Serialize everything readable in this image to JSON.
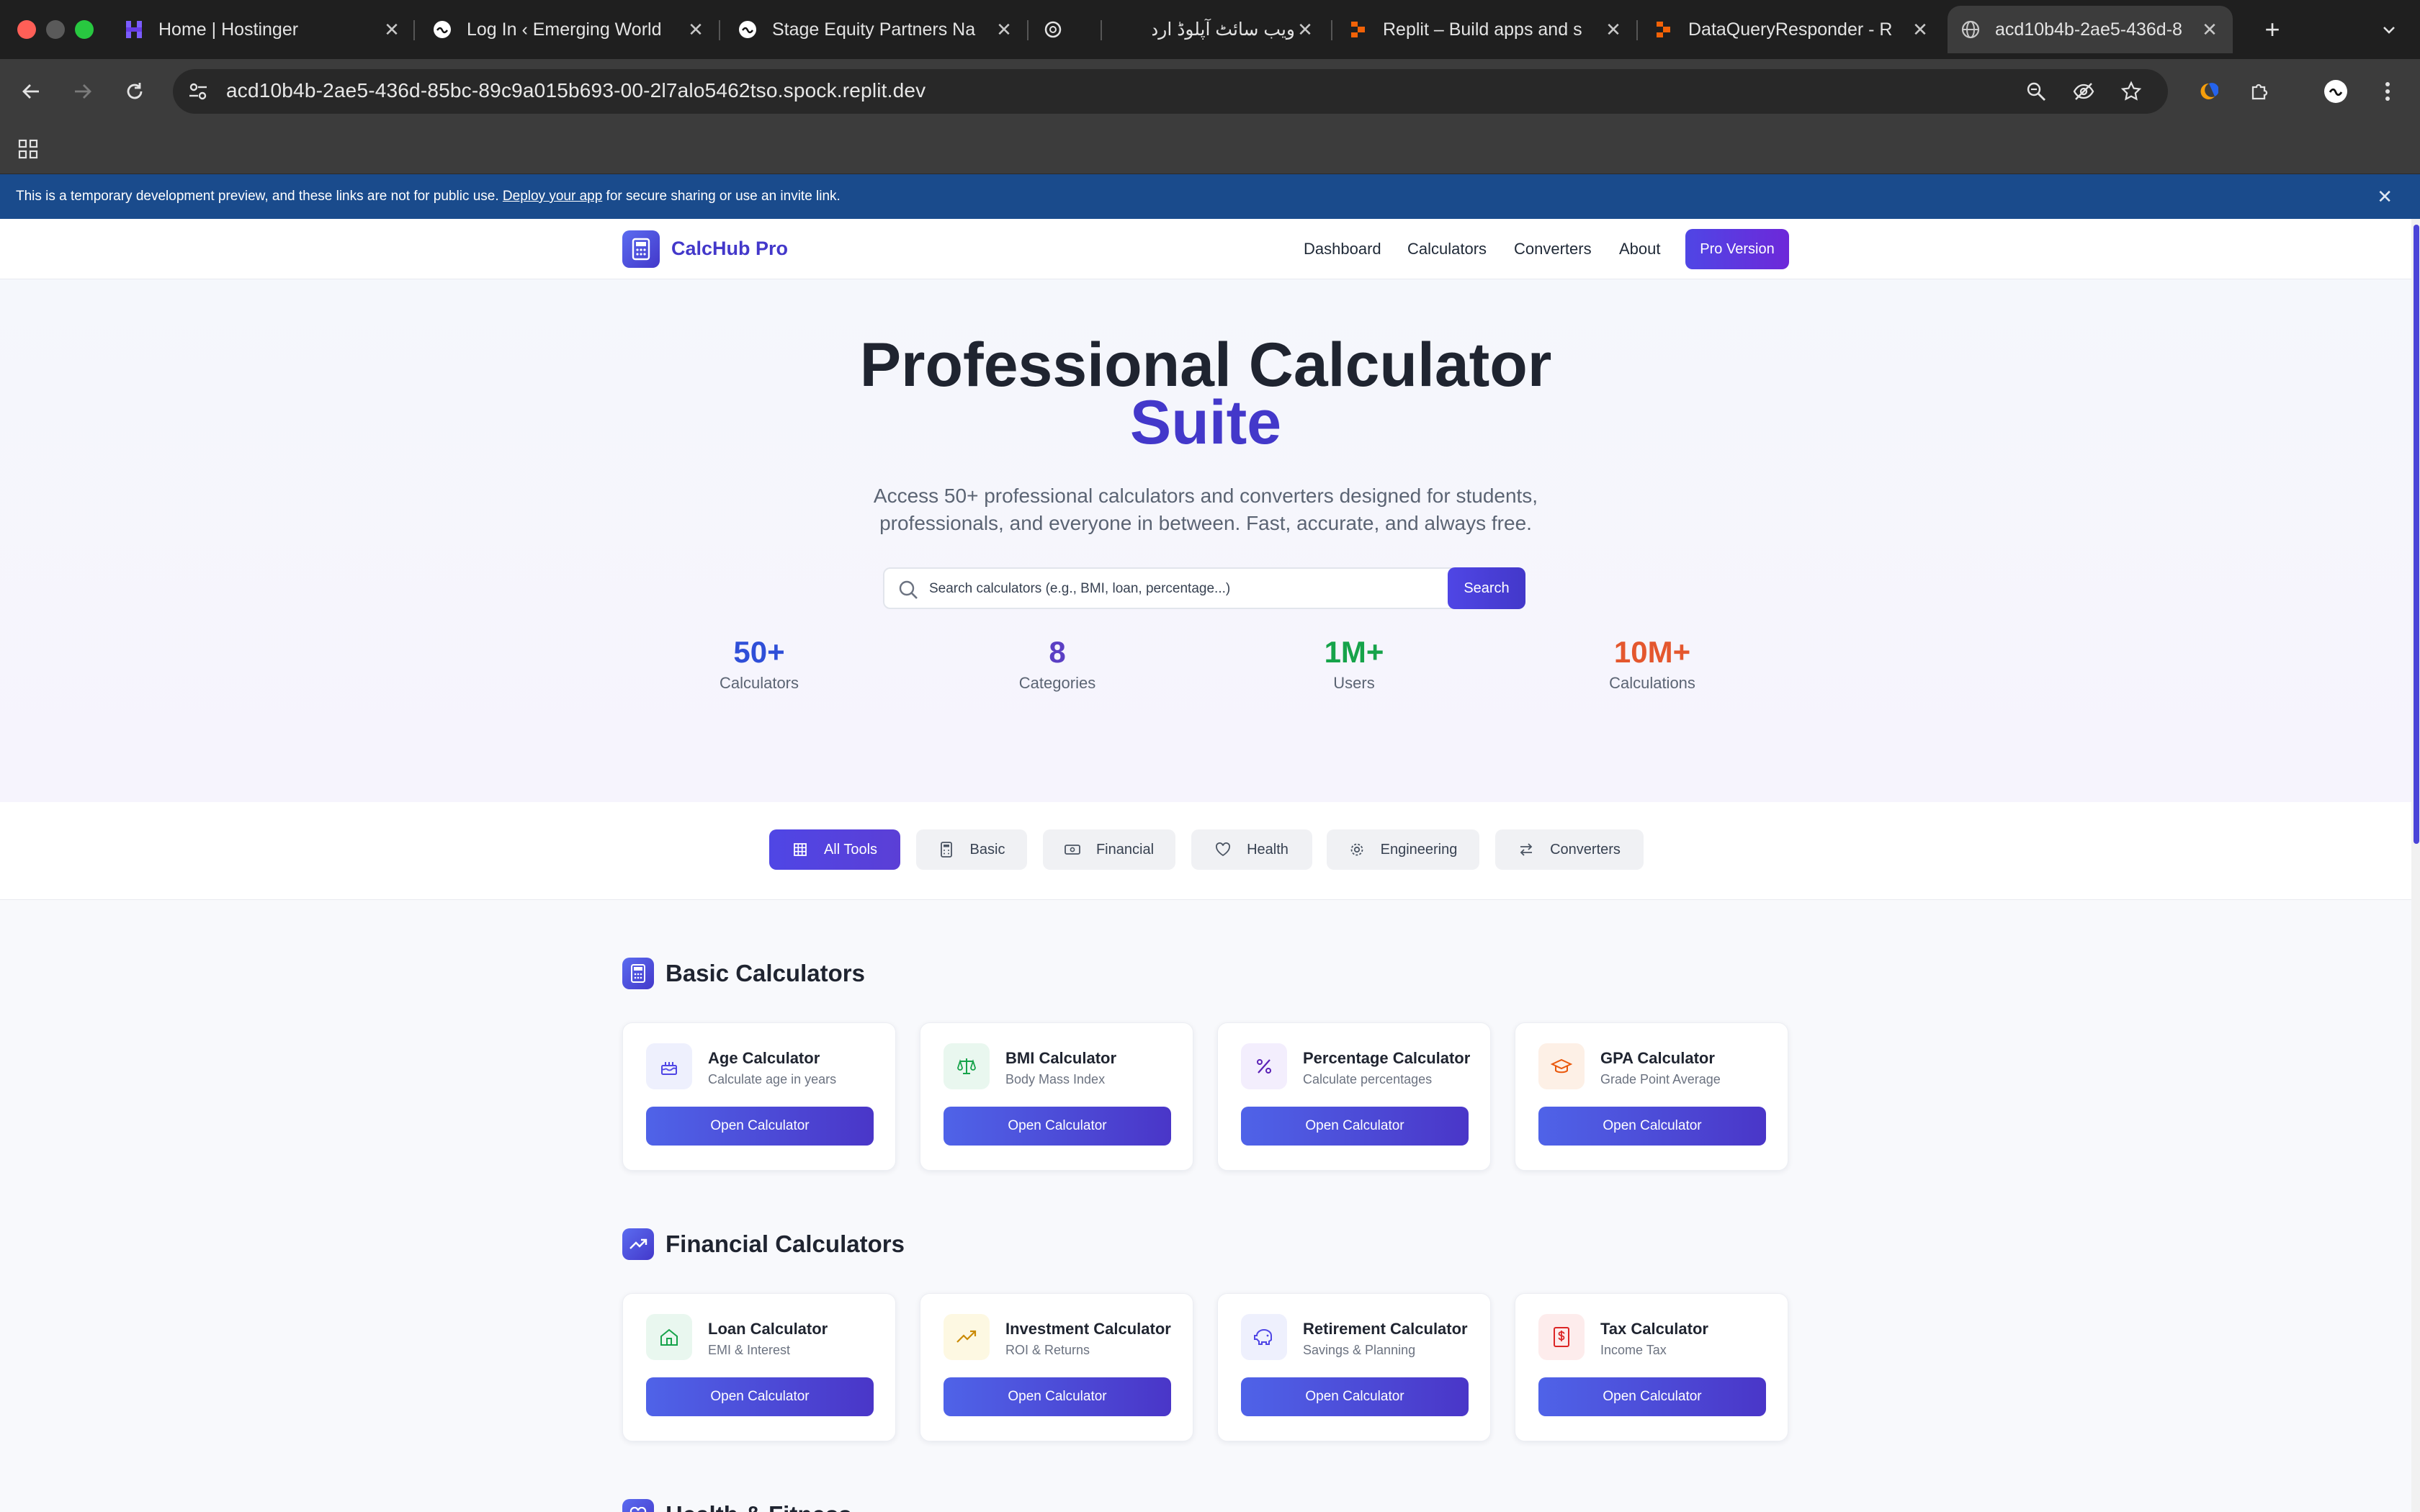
{
  "browser": {
    "tabs": [
      {
        "title": "Home | Hostinger",
        "icon": "hostinger-icon"
      },
      {
        "title": "Log In ‹ Emerging World",
        "icon": "web-icon"
      },
      {
        "title": "Stage Equity Partners Na",
        "icon": "web-icon"
      },
      {
        "title": "",
        "icon": "openai-icon"
      },
      {
        "title": "ویب سائٹ آپلوڈ اردو",
        "icon": "none"
      },
      {
        "title": "Replit – Build apps and s",
        "icon": "replit-icon"
      },
      {
        "title": "DataQueryResponder - R",
        "icon": "replit-icon"
      },
      {
        "title": "acd10b4b-2ae5-436d-8",
        "icon": "globe-icon"
      }
    ],
    "url": "acd10b4b-2ae5-436d-85bc-89c9a015b693-00-2l7alo5462tso.spock.replit.dev"
  },
  "banner": {
    "text_before": "This is a temporary development preview, and these links are not for public use. ",
    "link": "Deploy your app",
    "text_after": " for secure sharing or use an invite link."
  },
  "site": {
    "brand": "CalcHub Pro",
    "nav": [
      "Dashboard",
      "Calculators",
      "Converters",
      "About"
    ],
    "pro_button": "Pro Version"
  },
  "hero": {
    "title_line1": "Professional Calculator",
    "title_line2": "Suite",
    "subtitle": "Access 50+ professional calculators and converters designed for students, professionals, and everyone in between. Fast, accurate, and always free.",
    "search_placeholder": "Search calculators (e.g., BMI, loan, percentage...)",
    "search_button": "Search",
    "stats": [
      {
        "value": "50+",
        "label": "Calculators",
        "color": "#2f4fd8"
      },
      {
        "value": "8",
        "label": "Categories",
        "color": "#5b3fc4"
      },
      {
        "value": "1M+",
        "label": "Users",
        "color": "#16a34a"
      },
      {
        "value": "10M+",
        "label": "Calculations",
        "color": "#e4572e"
      }
    ]
  },
  "filters": [
    "All Tools",
    "Basic",
    "Financial",
    "Health",
    "Engineering",
    "Converters"
  ],
  "sections": [
    {
      "title": "Basic Calculators",
      "cards": [
        {
          "title": "Age Calculator",
          "subtitle": "Calculate age in years",
          "button": "Open Calculator"
        },
        {
          "title": "BMI Calculator",
          "subtitle": "Body Mass Index",
          "button": "Open Calculator"
        },
        {
          "title": "Percentage Calculator",
          "subtitle": "Calculate percentages",
          "button": "Open Calculator"
        },
        {
          "title": "GPA Calculator",
          "subtitle": "Grade Point Average",
          "button": "Open Calculator"
        }
      ]
    },
    {
      "title": "Financial Calculators",
      "cards": [
        {
          "title": "Loan Calculator",
          "subtitle": "EMI & Interest",
          "button": "Open Calculator"
        },
        {
          "title": "Investment Calculator",
          "subtitle": "ROI & Returns",
          "button": "Open Calculator"
        },
        {
          "title": "Retirement Calculator",
          "subtitle": "Savings & Planning",
          "button": "Open Calculator"
        },
        {
          "title": "Tax Calculator",
          "subtitle": "Income Tax",
          "button": "Open Calculator"
        }
      ]
    },
    {
      "title": "Health & Fitness"
    }
  ]
}
